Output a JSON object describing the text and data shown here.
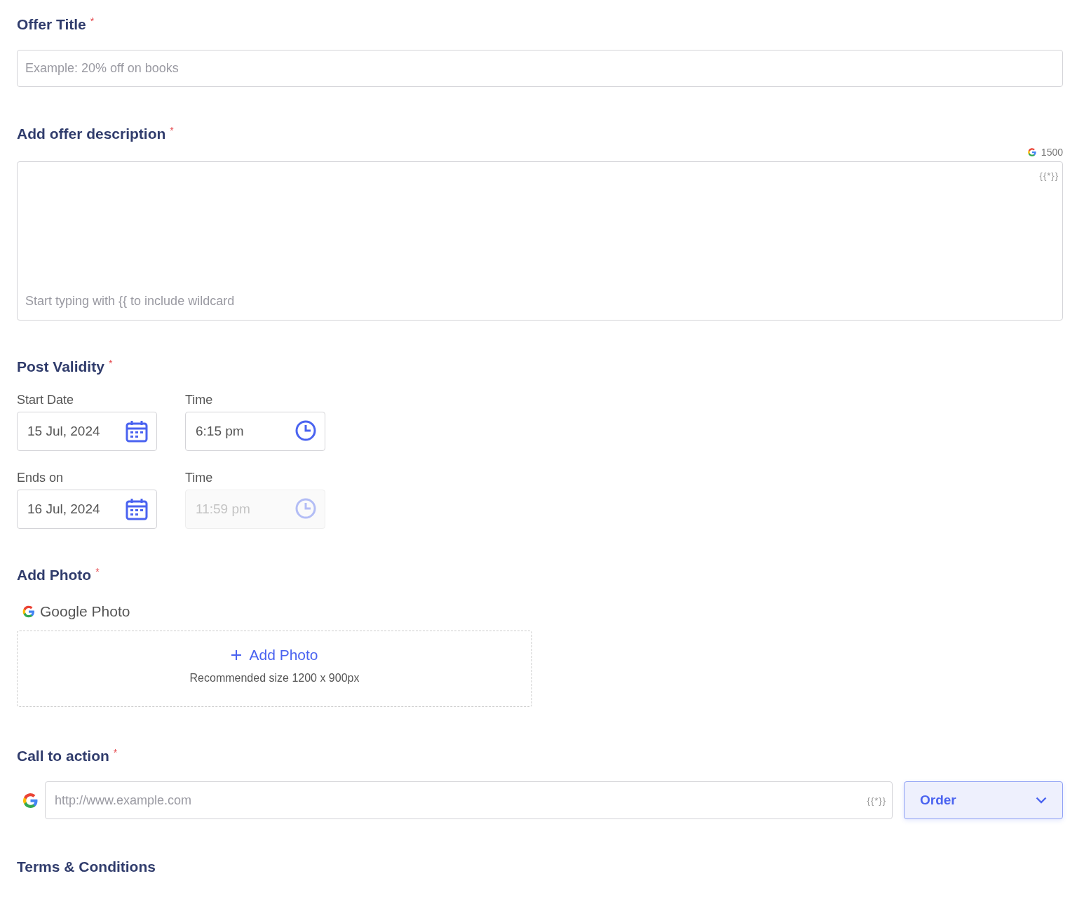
{
  "offer_title": {
    "label": "Offer Title",
    "required_mark": "*",
    "placeholder": "Example: 20% off on books"
  },
  "description": {
    "label": "Add offer description",
    "required_mark": "*",
    "char_limit": "1500",
    "wildcard": "{{*}}",
    "placeholder": "Start typing with {{ to include wildcard"
  },
  "post_validity": {
    "label": "Post Validity",
    "required_mark": "*",
    "rows": [
      {
        "date_label": "Start Date",
        "date": "15 Jul, 2024",
        "time_label": "Time",
        "time": "6:15 pm",
        "time_disabled": false
      },
      {
        "date_label": "Ends on",
        "date": "16 Jul, 2024",
        "time_label": "Time",
        "time": "11:59 pm",
        "time_disabled": true
      }
    ]
  },
  "add_photo": {
    "label": "Add Photo",
    "required_mark": "*",
    "source": "Google Photo",
    "button": "Add Photo",
    "hint": "Recommended size 1200 x 900px"
  },
  "call_to_action": {
    "label": "Call to action",
    "required_mark": "*",
    "placeholder": "http://www.example.com",
    "wildcard": "{{*}}",
    "action": "Order"
  },
  "terms": {
    "label": "Terms & Conditions"
  }
}
